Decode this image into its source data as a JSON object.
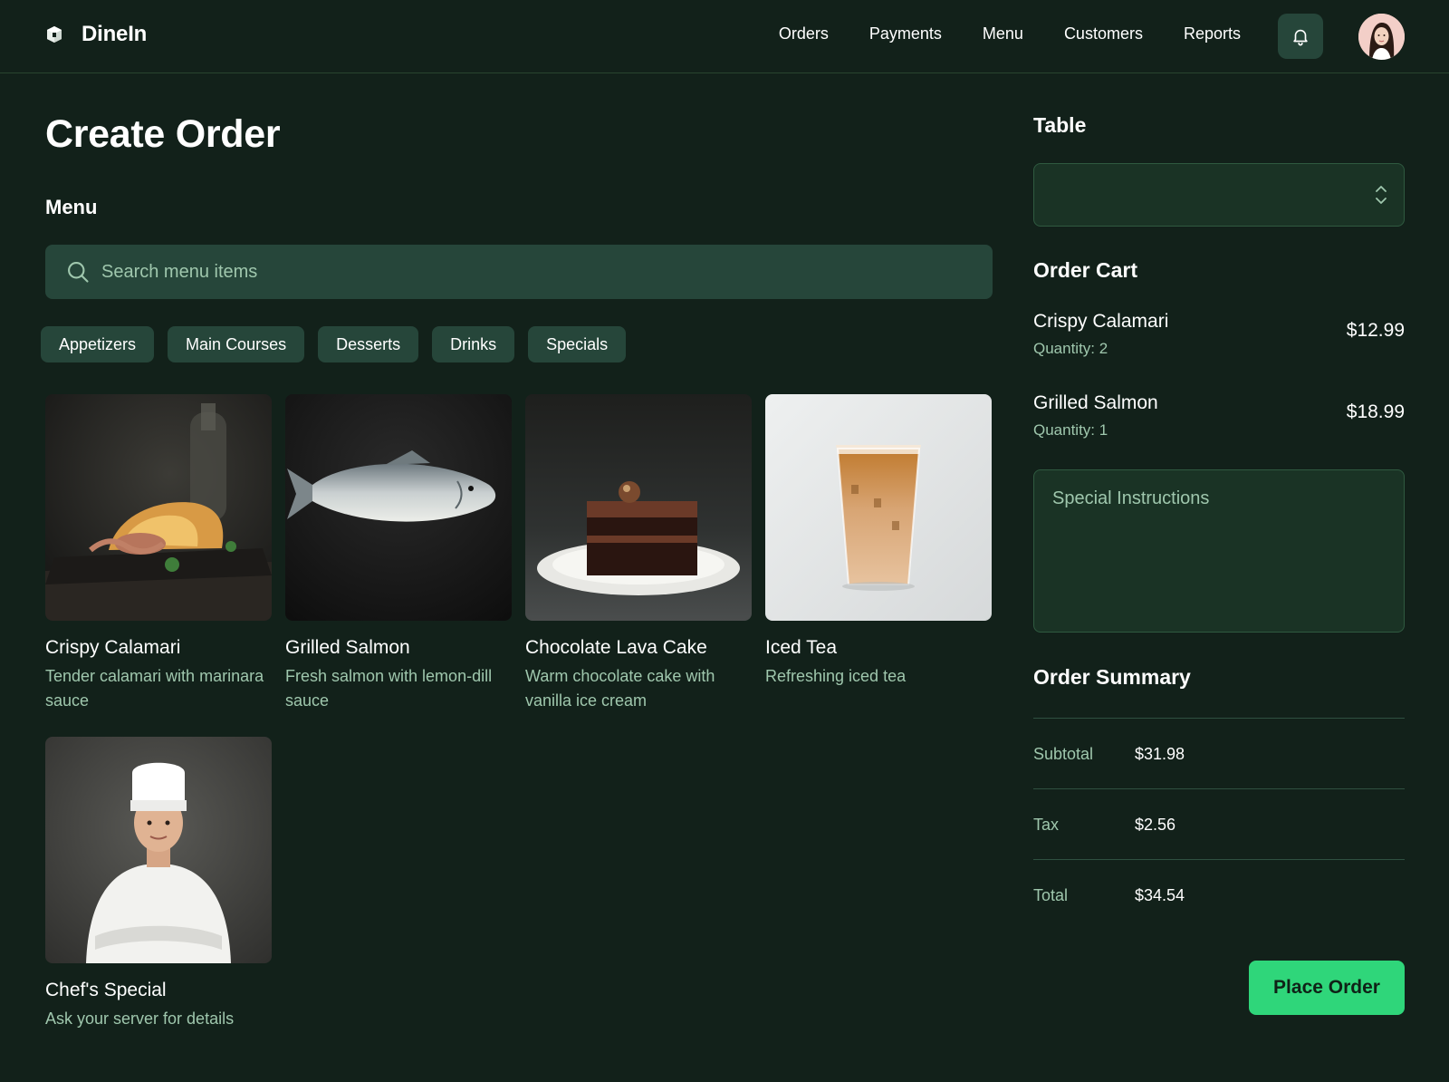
{
  "app": {
    "name": "DineIn"
  },
  "nav": [
    {
      "label": "Orders"
    },
    {
      "label": "Payments"
    },
    {
      "label": "Menu"
    },
    {
      "label": "Customers"
    },
    {
      "label": "Reports"
    }
  ],
  "page": {
    "title": "Create Order"
  },
  "menu": {
    "heading": "Menu",
    "search_placeholder": "Search menu items",
    "categories": [
      "Appetizers",
      "Main Courses",
      "Desserts",
      "Drinks",
      "Specials"
    ],
    "items": [
      {
        "name": "Crispy Calamari",
        "description": "Tender calamari with marinara sauce"
      },
      {
        "name": "Grilled Salmon",
        "description": "Fresh salmon with lemon-dill sauce"
      },
      {
        "name": "Chocolate Lava Cake",
        "description": "Warm chocolate cake with vanilla ice cream"
      },
      {
        "name": "Iced Tea",
        "description": "Refreshing iced tea"
      },
      {
        "name": "Chef's Special",
        "description": "Ask your server for details"
      }
    ]
  },
  "table": {
    "heading": "Table",
    "selected": ""
  },
  "cart": {
    "heading": "Order Cart",
    "items": [
      {
        "name": "Crispy Calamari",
        "quantity": "Quantity: 2",
        "price": "$12.99"
      },
      {
        "name": "Grilled Salmon",
        "quantity": "Quantity: 1",
        "price": "$18.99"
      }
    ],
    "instructions_placeholder": "Special Instructions"
  },
  "summary": {
    "heading": "Order Summary",
    "rows": [
      {
        "label": "Subtotal",
        "value": "$31.98"
      },
      {
        "label": "Tax",
        "value": "$2.56"
      },
      {
        "label": "Total",
        "value": "$34.54"
      }
    ]
  },
  "actions": {
    "place_order": "Place Order"
  },
  "colors": {
    "background": "#12211a",
    "surface": "#26463a",
    "muted_text": "#9fc7ad",
    "accent": "#2fd67a"
  }
}
